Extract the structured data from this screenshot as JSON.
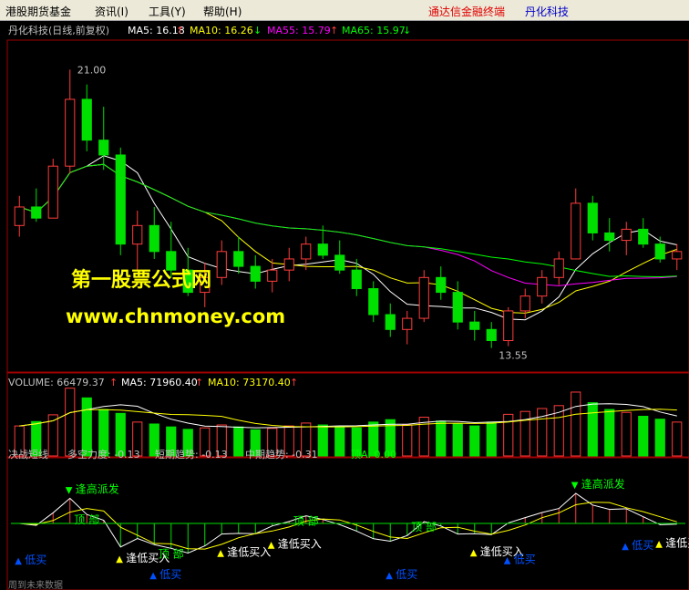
{
  "menu": {
    "items": [
      "港股期货基金",
      "资讯(I)",
      "工具(Y)",
      "帮助(H)"
    ],
    "brand": "通达信金融终端",
    "stock": "丹化科技"
  },
  "price_panel": {
    "title": "丹化科技(日线,前复权)",
    "ma5": "MA5: 16.18",
    "ma10": "MA10: 16.26",
    "ma55": "MA55: 15.79",
    "ma65": "MA65: 15.97",
    "high_label": "21.00",
    "low_label": "13.55"
  },
  "watermark": {
    "line1": "第一股票公式网",
    "line2": "www.chnmoney.com"
  },
  "volume_panel": {
    "vol": "VOLUME: 66479.37",
    "ma5": "MA5: 71960.40",
    "ma10": "MA10: 73170.40"
  },
  "indicator_panel": {
    "name": "决战短线",
    "duokong": "多空力度: -0.13",
    "short_trend": "短期趋势: -0.13",
    "mid_trend": "中期趋势: -0.31",
    "top_a": "顶A: 0.00",
    "footer": "周到未来数据",
    "signals": {
      "sell": "逢高派发",
      "top": "顶 部",
      "buy": "逢低买入",
      "bottom": "低买"
    }
  },
  "colors": {
    "up": "#ff3c3c",
    "down": "#00e000",
    "ma5": "#ffffff",
    "ma10": "#ffff00",
    "ma55": "#ff00ff",
    "ma65": "#00ff00",
    "watermark": "#ffff00",
    "signal_sell": "#00ff00",
    "signal_buy": "#0050ff"
  },
  "chart_data": {
    "type": "candlestick",
    "price": [
      [
        16.8,
        17.6,
        16.5,
        17.3
      ],
      [
        17.3,
        17.8,
        16.9,
        17.0
      ],
      [
        17.0,
        18.6,
        17.0,
        18.4
      ],
      [
        18.4,
        21.0,
        18.2,
        20.2
      ],
      [
        20.2,
        20.6,
        18.8,
        19.1
      ],
      [
        19.1,
        20.0,
        18.3,
        18.7
      ],
      [
        18.7,
        18.9,
        16.0,
        16.3
      ],
      [
        16.3,
        17.2,
        15.6,
        16.8
      ],
      [
        16.8,
        17.3,
        15.9,
        16.1
      ],
      [
        16.1,
        16.9,
        15.4,
        15.6
      ],
      [
        15.6,
        16.2,
        14.9,
        15.0
      ],
      [
        15.0,
        15.8,
        14.6,
        15.4
      ],
      [
        15.4,
        16.4,
        15.2,
        16.1
      ],
      [
        16.1,
        16.5,
        15.5,
        15.7
      ],
      [
        15.7,
        16.0,
        15.1,
        15.3
      ],
      [
        15.3,
        15.9,
        15.0,
        15.6
      ],
      [
        15.6,
        16.2,
        15.3,
        15.9
      ],
      [
        15.9,
        16.5,
        15.6,
        16.3
      ],
      [
        16.3,
        16.8,
        15.9,
        16.0
      ],
      [
        16.0,
        16.4,
        15.5,
        15.6
      ],
      [
        15.6,
        15.9,
        14.9,
        15.1
      ],
      [
        15.1,
        15.3,
        14.2,
        14.4
      ],
      [
        14.4,
        14.7,
        13.8,
        14.0
      ],
      [
        14.0,
        14.5,
        13.6,
        14.3
      ],
      [
        14.3,
        15.6,
        14.2,
        15.4
      ],
      [
        15.4,
        15.7,
        14.8,
        15.0
      ],
      [
        15.0,
        15.3,
        14.0,
        14.2
      ],
      [
        14.2,
        14.5,
        13.7,
        14.0
      ],
      [
        14.0,
        14.2,
        13.5,
        13.7
      ],
      [
        13.7,
        14.6,
        13.55,
        14.5
      ],
      [
        14.5,
        15.1,
        14.3,
        14.9
      ],
      [
        14.9,
        15.6,
        14.7,
        15.4
      ],
      [
        15.4,
        16.1,
        15.2,
        15.9
      ],
      [
        15.9,
        17.8,
        15.9,
        17.4
      ],
      [
        17.4,
        17.6,
        16.4,
        16.6
      ],
      [
        16.6,
        17.0,
        16.1,
        16.4
      ],
      [
        16.4,
        16.9,
        16.0,
        16.7
      ],
      [
        16.7,
        17.0,
        16.2,
        16.3
      ],
      [
        16.3,
        16.5,
        15.8,
        15.9
      ],
      [
        15.9,
        16.3,
        15.6,
        16.1
      ]
    ],
    "volume": [
      62,
      71,
      85,
      140,
      120,
      96,
      88,
      70,
      66,
      60,
      55,
      58,
      64,
      60,
      54,
      57,
      62,
      68,
      64,
      60,
      58,
      70,
      75,
      64,
      80,
      72,
      66,
      62,
      70,
      86,
      92,
      98,
      104,
      132,
      110,
      96,
      90,
      82,
      76,
      70
    ],
    "signals": [
      {
        "label": "逢高派发",
        "kind": "sell",
        "idx": 3
      },
      {
        "label": "顶 部",
        "kind": "top",
        "idx": 4
      },
      {
        "label": "顶 部",
        "kind": "top",
        "idx": 9
      },
      {
        "label": "顶 部",
        "kind": "top",
        "idx": 17
      },
      {
        "label": "顶 部",
        "kind": "top",
        "idx": 24
      },
      {
        "label": "逢高派发",
        "kind": "sell",
        "idx": 33
      },
      {
        "label": "逢低买入",
        "kind": "buy",
        "idx": 6
      },
      {
        "label": "逢低买入",
        "kind": "buy",
        "idx": 12
      },
      {
        "label": "逢低买入",
        "kind": "buy",
        "idx": 15
      },
      {
        "label": "逢低买入",
        "kind": "buy",
        "idx": 27
      },
      {
        "label": "逢低买入",
        "kind": "buy",
        "idx": 38
      },
      {
        "label": "低买",
        "kind": "bottom",
        "idx": 0
      },
      {
        "label": "低买",
        "kind": "bottom",
        "idx": 8
      },
      {
        "label": "低买",
        "kind": "bottom",
        "idx": 22
      },
      {
        "label": "低买",
        "kind": "bottom",
        "idx": 29
      },
      {
        "label": "低买",
        "kind": "bottom",
        "idx": 36
      }
    ]
  }
}
